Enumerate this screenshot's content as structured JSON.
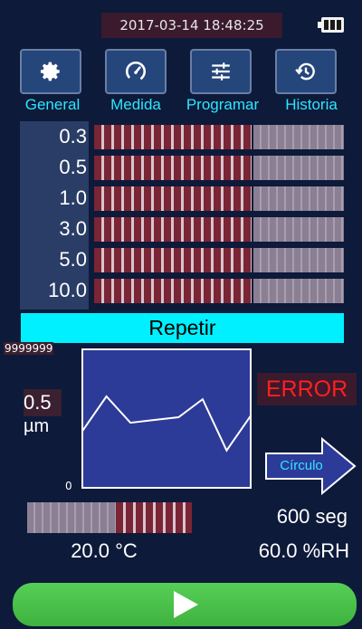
{
  "status": {
    "datetime": "2017-03-14 18:48:25",
    "battery_icon": "battery-full-icon"
  },
  "nav": [
    {
      "label": "General",
      "icon": "gear-icon"
    },
    {
      "label": "Medida",
      "icon": "gauge-icon"
    },
    {
      "label": "Programar",
      "icon": "sliders-icon"
    },
    {
      "label": "Historia",
      "icon": "history-icon"
    }
  ],
  "particle_sizes": [
    {
      "size": "0.3",
      "level": 0.63
    },
    {
      "size": "0.5",
      "level": 0.63
    },
    {
      "size": "1.0",
      "level": 0.63
    },
    {
      "size": "3.0",
      "level": 0.63
    },
    {
      "size": "5.0",
      "level": 0.63
    },
    {
      "size": "10.0",
      "level": 0.63
    }
  ],
  "mode": "Repetir",
  "graph": {
    "y_max_label": "9999999",
    "y_min_label": "0",
    "selected_size_value": "0.5",
    "selected_size_unit": "µm",
    "trend": [
      0.41,
      0.66,
      0.47,
      0.49,
      0.51,
      0.64,
      0.27,
      0.52
    ]
  },
  "error_text": "ERROR",
  "cycle_label": "Círculo",
  "sample_progress": 0.54,
  "duration": "600 seg",
  "temperature": "20.0 °C",
  "humidity": "60.0 %RH",
  "start_icon": "play-icon",
  "colors": {
    "background": "#0d1a3a",
    "accent_cyan": "#00f0ff",
    "error_red": "#ff2020",
    "start_green": "#46b946"
  }
}
